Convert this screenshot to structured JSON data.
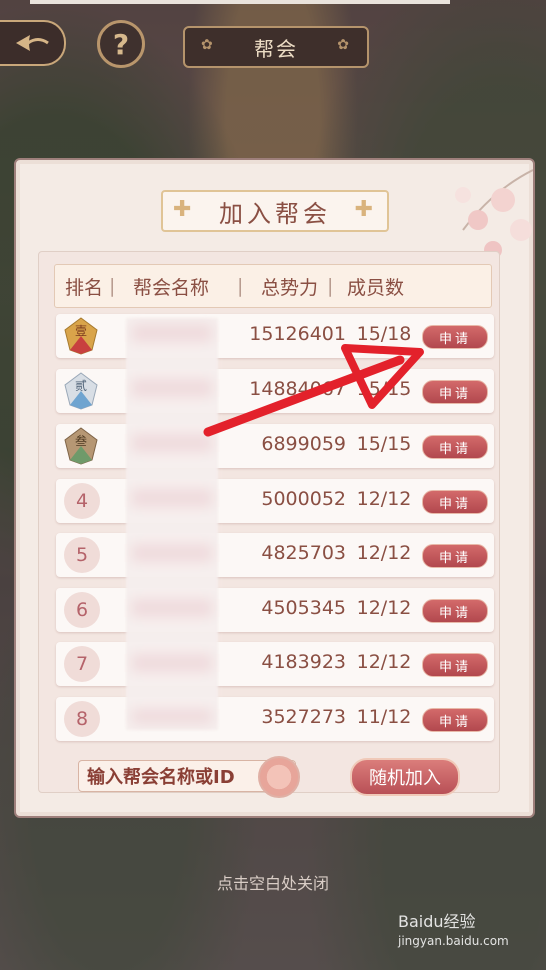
{
  "topbar": {
    "title": "帮会",
    "help": "?"
  },
  "dialog": {
    "title": "加入帮会",
    "headers": {
      "rank": "排名",
      "name": "帮会名称",
      "power": "总势力",
      "members": "成员数"
    },
    "rows": [
      {
        "rank": "壹",
        "power": "15126401",
        "members": "15/18",
        "apply": "申请"
      },
      {
        "rank": "贰",
        "power": "14884067",
        "members": "15/15",
        "apply": "申请"
      },
      {
        "rank": "叁",
        "power": "6899059",
        "members": "15/15",
        "apply": "申请"
      },
      {
        "rank": "4",
        "power": "5000052",
        "members": "12/12",
        "apply": "申请"
      },
      {
        "rank": "5",
        "power": "4825703",
        "members": "12/12",
        "apply": "申请"
      },
      {
        "rank": "6",
        "power": "4505345",
        "members": "12/12",
        "apply": "申请"
      },
      {
        "rank": "7",
        "power": "4183923",
        "members": "12/12",
        "apply": "申请"
      },
      {
        "rank": "8",
        "power": "3527273",
        "members": "11/12",
        "apply": "申请"
      }
    ],
    "search_placeholder": "输入帮会名称或ID",
    "random_join": "随机加入"
  },
  "hint": "点击空白处关闭",
  "watermark": {
    "brand": "Baidu经验",
    "url": "jingyan.baidu.com"
  },
  "colors": {
    "accent": "#b2484e",
    "text": "#8a4f43",
    "annotation": "#e3212b"
  }
}
